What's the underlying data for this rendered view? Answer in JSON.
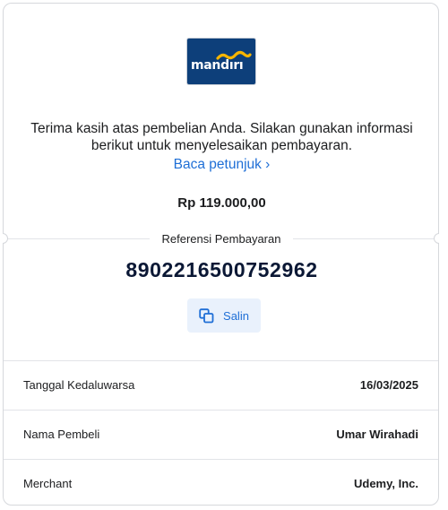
{
  "bank": {
    "logo_text": "mandırı",
    "brand_color": "#0d3f7a",
    "accent_color": "#f7b500"
  },
  "message": "Terima kasih atas pembelian Anda. Silakan gunakan informasi berikut untuk menyelesaikan pembayaran.",
  "instructions_link": "Baca petunjuk ›",
  "amount": "Rp 119.000,00",
  "reference": {
    "label": "Referensi Pembayaran",
    "number": "8902216500752962"
  },
  "copy_button": {
    "label": "Salin",
    "icon": "copy-icon"
  },
  "details": [
    {
      "label": "Tanggal Kedaluwarsa",
      "value": "16/03/2025"
    },
    {
      "label": "Nama Pembeli",
      "value": "Umar Wirahadi"
    },
    {
      "label": "Merchant",
      "value": "Udemy, Inc."
    }
  ],
  "colors": {
    "link": "#1f6fd6",
    "copy_bg": "#e9f1fc",
    "ref_number": "#0b1835"
  }
}
